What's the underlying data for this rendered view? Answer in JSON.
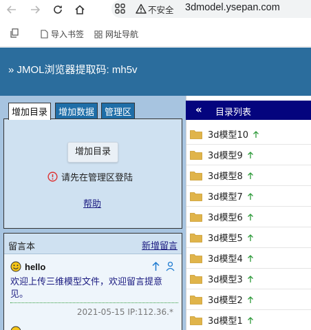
{
  "browser": {
    "security_label": "不安全",
    "url": "3dmodel.ysepan.com",
    "bookmarks": [
      {
        "label": "导入书签"
      },
      {
        "label": "网址导航"
      }
    ]
  },
  "header": {
    "title": "» JMOL浏览器提取码: mh5v"
  },
  "tabs": [
    {
      "label": "增加目录",
      "active": true
    },
    {
      "label": "增加数据",
      "active": false
    },
    {
      "label": "管理区",
      "active": false
    }
  ],
  "panel": {
    "add_button": "增加目录",
    "login_notice": "请先在管理区登陆",
    "help_link": "帮助"
  },
  "guestbook": {
    "title": "留言本",
    "new_link": "新增留言",
    "messages": [
      {
        "name": "hello",
        "body": "欢迎上传三维模型文件，欢迎留言提意见。",
        "meta": "2021-05-15 IP:112.36.*"
      }
    ]
  },
  "directory": {
    "title": "目录列表",
    "items": [
      {
        "label": "3d模型10"
      },
      {
        "label": "3d模型9"
      },
      {
        "label": "3d模型8"
      },
      {
        "label": "3d模型7"
      },
      {
        "label": "3d模型6"
      },
      {
        "label": "3d模型5"
      },
      {
        "label": "3d模型4"
      },
      {
        "label": "3d模型3"
      },
      {
        "label": "3d模型2"
      },
      {
        "label": "3d模型1"
      }
    ]
  },
  "colors": {
    "header_bg": "#2b6d9d",
    "dir_header_bg": "#04047e",
    "left_bg": "#a7c4e0",
    "folder": "#e0b44a",
    "up_arrow": "#2e9a3a",
    "link": "#1a1a80"
  }
}
